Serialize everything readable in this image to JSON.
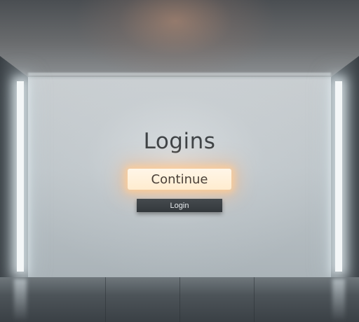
{
  "title": "Logins",
  "buttons": {
    "continue_label": "Continue",
    "login_label": "Login"
  },
  "colors": {
    "continue_glow": "#ffce96",
    "continue_fill": "#fff3e2",
    "login_fill": "#3a3f43",
    "wall": "#c4cacd"
  }
}
